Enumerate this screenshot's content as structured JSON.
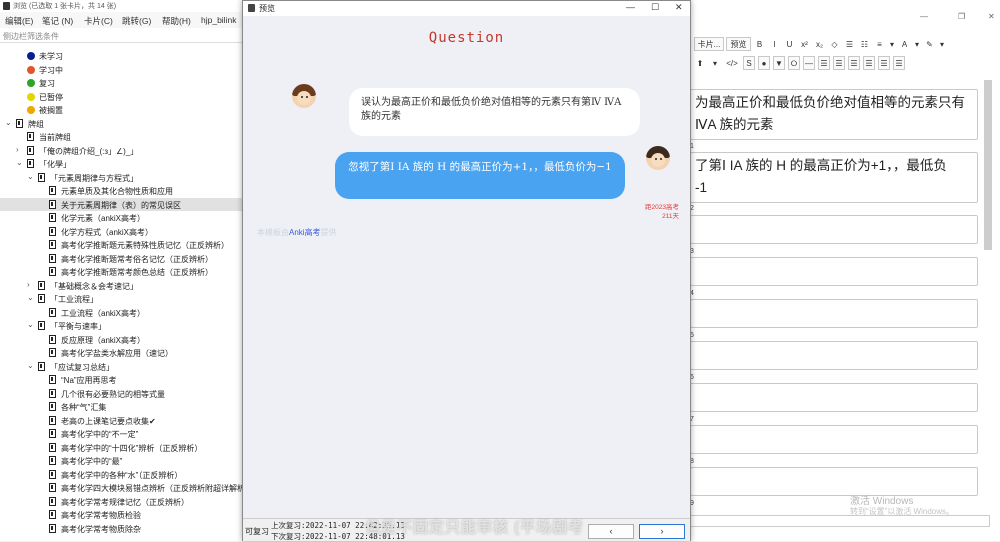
{
  "browser": {
    "title": "浏览 (已选取 1 张卡片，共 14 张)",
    "menu": [
      "编辑(E)",
      "笔记 (N)",
      "卡片(C)",
      "跳转(G)",
      "帮助(H)",
      "hjp_bilink"
    ],
    "filter_placeholder": "侧边栏筛选条件"
  },
  "sidebar": {
    "status_items": [
      {
        "label": "未学习",
        "color": "#0a1f8f"
      },
      {
        "label": "学习中",
        "color": "#e0572a"
      },
      {
        "label": "复习",
        "color": "#2aa62a"
      },
      {
        "label": "已暂停",
        "color": "#e0d800"
      },
      {
        "label": "被搁置",
        "color": "#f0a800"
      }
    ],
    "tree": [
      {
        "label": "牌组",
        "indent": 0,
        "chev": "⌄"
      },
      {
        "label": "当前牌组",
        "indent": 1,
        "chev": ""
      },
      {
        "label": "「俺の牌组介绍_(:з」∠)_」",
        "indent": 1,
        "chev": "›"
      },
      {
        "label": "「化學」",
        "indent": 1,
        "chev": "⌄"
      },
      {
        "label": "「元素周期律与方程式」",
        "indent": 2,
        "chev": "⌄"
      },
      {
        "label": "元素单质及其化合物性质和应用",
        "indent": 3,
        "chev": ""
      },
      {
        "label": "关于元素周期律（表）的常见误区",
        "indent": 3,
        "chev": "",
        "selected": true
      },
      {
        "label": "化学元素（ankiX高考）",
        "indent": 3,
        "chev": ""
      },
      {
        "label": "化学方程式（ankiX高考）",
        "indent": 3,
        "chev": ""
      },
      {
        "label": "高考化学推断题元素特殊性质记忆（正反辨析）",
        "indent": 3,
        "chev": ""
      },
      {
        "label": "高考化学推断题常考俗名记忆（正反辨析）",
        "indent": 3,
        "chev": ""
      },
      {
        "label": "高考化学推断题常考颜色总结（正反辨析）",
        "indent": 3,
        "chev": ""
      },
      {
        "label": "「基础概念＆会考速记」",
        "indent": 2,
        "chev": "›"
      },
      {
        "label": "「工业流程」",
        "indent": 2,
        "chev": "⌄"
      },
      {
        "label": "工业流程（ankiX高考）",
        "indent": 3,
        "chev": ""
      },
      {
        "label": "「平衡与速率」",
        "indent": 2,
        "chev": "⌄"
      },
      {
        "label": "反应原理（ankiX高考）",
        "indent": 3,
        "chev": ""
      },
      {
        "label": "高考化学盐类水解应用（速记）",
        "indent": 3,
        "chev": ""
      },
      {
        "label": "「应试复习总结」",
        "indent": 2,
        "chev": "⌄"
      },
      {
        "label": "“Na”应用再思考",
        "indent": 3,
        "chev": ""
      },
      {
        "label": "几个很有必要熟记的相等式量",
        "indent": 3,
        "chev": ""
      },
      {
        "label": "各种“气”汇集",
        "indent": 3,
        "chev": ""
      },
      {
        "label": "老高の上课笔记要点收集✔",
        "indent": 3,
        "chev": ""
      },
      {
        "label": "高考化学中的“不一定”",
        "indent": 3,
        "chev": ""
      },
      {
        "label": "高考化学中的“十四化”辨析（正反辨析）",
        "indent": 3,
        "chev": ""
      },
      {
        "label": "高考化学中的“最”",
        "indent": 3,
        "chev": ""
      },
      {
        "label": "高考化学中的各种“水”（正反辨析）",
        "indent": 3,
        "chev": ""
      },
      {
        "label": "高考化学四大模块易错点辨析（正反辨析附超详解析",
        "indent": 3,
        "chev": ""
      },
      {
        "label": "高考化学常考规律记忆（正反辨析）",
        "indent": 3,
        "chev": ""
      },
      {
        "label": "高考化学常考物质检验",
        "indent": 3,
        "chev": ""
      },
      {
        "label": "高考化学常考物质除杂",
        "indent": 3,
        "chev": ""
      }
    ]
  },
  "editor": {
    "toolbar1": [
      "卡片...",
      "预览",
      "B",
      "I",
      "U",
      "x²",
      "x₂",
      "◇",
      "☰",
      "☷",
      "≡",
      "▾",
      "A",
      "▾",
      "✎",
      "▾"
    ],
    "toolbar2": [
      "⬆",
      "▾",
      "</>",
      "S",
      "●",
      "▼",
      "⭘",
      "—",
      "☰",
      "☰",
      "☰",
      "☰",
      "☰",
      "☰"
    ],
    "fields": [
      {
        "num": "",
        "text": "为最高正价和最低负价绝对值相等的元素只有\nⅣA 族的元素"
      },
      {
        "num": "1",
        "text": "了第Ⅰ IA 族的 H 的最高正价为+1，，最低负\n-1"
      },
      {
        "num": "2",
        "text": ""
      },
      {
        "num": "3",
        "text": ""
      },
      {
        "num": "4",
        "text": ""
      },
      {
        "num": "5",
        "text": ""
      },
      {
        "num": "6",
        "text": ""
      },
      {
        "num": "7",
        "text": ""
      },
      {
        "num": "8",
        "text": ""
      },
      {
        "num": "9",
        "text": ""
      }
    ],
    "watermark1": "激活 Windows",
    "watermark2": "转到“设置”以激活 Windows。"
  },
  "dialog": {
    "title": "预览",
    "question_title": "Question",
    "question_text": "误认为最高正价和最低负价绝对值相等的元素只有第Ⅳ ⅣA 族的元素",
    "answer_text": "忽视了第Ⅰ ⅠA 族的 H 的最高正价为+1，，最低负价为−1",
    "countdown": "距2023高考\n211天",
    "credit_prefix": "本模板由",
    "credit_link": "Anki高考",
    "credit_suffix": "提供",
    "footer": {
      "left_label": "可复习",
      "last_review": "上次复习:2022-11-07 22:42:35.13",
      "next_review": "下次复习:2022-11-07 22:48:01.13",
      "prev": "‹",
      "next": "›"
    },
    "overlay_caption": "但是不固定只能审核 (平场剧考"
  }
}
